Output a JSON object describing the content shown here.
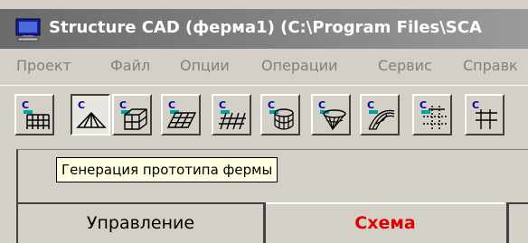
{
  "window": {
    "title": "Structure CAD (ферма1) (C:\\Program Files\\SCA"
  },
  "menu": {
    "items": [
      "Проект",
      "Файл",
      "Опции",
      "Операции",
      "Сервис",
      "Справк"
    ]
  },
  "toolbar": {
    "buttons": [
      {
        "icon": "frame-grid-icon",
        "badge": "C"
      },
      {
        "icon": "truss-prototype-icon",
        "badge": "C",
        "pressed": true
      },
      {
        "icon": "spatial-frame-icon",
        "badge": "C"
      },
      {
        "icon": "slab-grid-icon",
        "badge": "C"
      },
      {
        "icon": "grillage-icon",
        "badge": "C"
      },
      {
        "icon": "cylinder-shell-icon",
        "badge": "C"
      },
      {
        "icon": "cone-shell-icon",
        "badge": "C"
      },
      {
        "icon": "surface-shell-icon",
        "badge": "C"
      },
      {
        "icon": "dotted-grid-icon",
        "badge": "C"
      }
    ]
  },
  "tooltip": {
    "text": "Генерация прототипа фермы"
  },
  "tabs": [
    {
      "label": "Управление",
      "active": false
    },
    {
      "label": "Схема",
      "active": true
    }
  ]
}
